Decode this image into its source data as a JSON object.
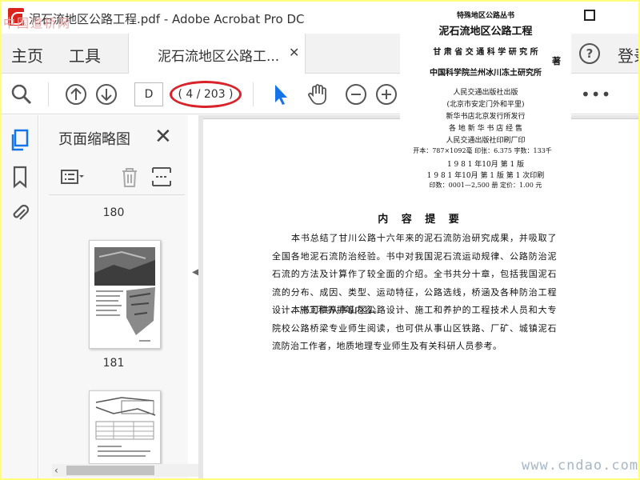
{
  "window": {
    "title": "泥石流地区公路工程.pdf - Adobe Acrobat Pro DC",
    "watermark_top": "中国道桥网"
  },
  "tabs": {
    "home": "主页",
    "tools": "工具",
    "document": "泥石流地区公路工...",
    "help": "?",
    "signin": "登录"
  },
  "toolbar": {
    "page_input": "D",
    "page_count": "( 4 / 203 )",
    "more": "•••"
  },
  "thumbnails": {
    "title": "页面缩略图",
    "pages": [
      {
        "label": "180"
      },
      {
        "label": "181"
      },
      {
        "label": ""
      }
    ]
  },
  "document": {
    "heading": "内 容 提 要",
    "paragraphs": [
      "本书总结了甘川公路十六年来的泥石流防治研究成果，并吸取了全国各地泥石流防治经验。书中对我国泥石流运动规律、公路防治泥石流的方法及计算作了较全面的介绍。全书共分十章，包括我国泥石流的分布、成因、类型、运动特征，公路选线，桥涵及各种防治工程设计、施工和养护等内容。",
      "本书可供从事山区公路设计、施工和养护的工程技术人员和大专院校公路桥梁专业师生阅读，也可供从事山区铁路、厂矿、城镇泥石流防治工作者，地质地理专业师生及有关科研人员参考。"
    ]
  },
  "copyright_page": {
    "series": "特殊地区公路丛书",
    "book_title": "泥石流地区公路工程",
    "author1": "甘 肃 省 交 通 科 学 研 究 所",
    "author2": "中国科学院兰州冰川冻土研究所",
    "zhu": "著",
    "publisher": "人民交通出版社出版",
    "address": "(北京市安定门外和平里)",
    "distributor": "新华书店北京发行所发行",
    "sellers": "各 地 新 华 书 店 经 售",
    "printer": "人民交通出版社印刷厂印",
    "specs": "开本：787×1092毫  印张：6.375 字数：133千",
    "edition": "1 9 8 1 年10月  第 1 版",
    "printing": "1 9 8 1 年10月  第 1 版  第 1 次印刷",
    "count_price": "印数：0001—2,500 册   定价：1.00 元"
  },
  "watermark_bottom": "www.cndao.com",
  "colors": {
    "highlight_ring": "#d8232a",
    "screenshot_border": "#ffff7a",
    "cursor_arrow": "#1473e6"
  }
}
